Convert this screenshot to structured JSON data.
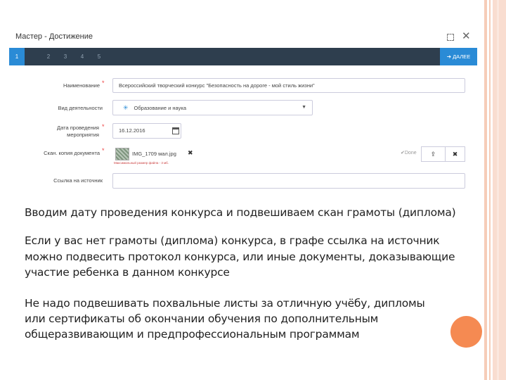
{
  "window": {
    "title": "Мастер - Достижение"
  },
  "stepbar": {
    "steps": [
      "1",
      "2",
      "3",
      "4",
      "5"
    ],
    "next_label": "➔ ДАЛЕЕ"
  },
  "form": {
    "name_label": "Наименование",
    "name_value": "Всероссийский творческий конкурс \"Безопасность на дороге - мой стиль жизни\"",
    "activity_label": "Вид деятельности",
    "activity_value": "Образование и наука",
    "date_label_1": "Дата проведения",
    "date_label_2": "мероприятия",
    "date_value": "16.12.2016",
    "scan_label": "Скан. копия документа",
    "scan_file": "IMG_1709 мал.jpg",
    "scan_hint": "Максимальный размер файла - 3 мб.",
    "scan_status": "Done",
    "link_label": "Ссылка на источник",
    "link_value": ""
  },
  "text": {
    "p1": "Вводим дату проведения конкурса и подвешиваем скан грамоты (диплома)",
    "p2_1": "Если у вас нет грамоты (диплома) конкурса, в графе ссылка на источник",
    "p2_2": "можно подвесить протокол конкурса, или иные документы, доказывающие",
    "p2_3": "участие ребенка в данном конкурсе",
    "p3_1": "Не надо подвешивать похвальные листы за отличную учёбу, дипломы",
    "p3_2": "или сертификаты об окончании обучения по дополнительным",
    "p3_3": "общеразвивающим и предпрофессиональным программам"
  },
  "colors": {
    "accent": "#2a8bd6",
    "stepbar": "#2e3e4e",
    "decor": "#f58a52"
  }
}
